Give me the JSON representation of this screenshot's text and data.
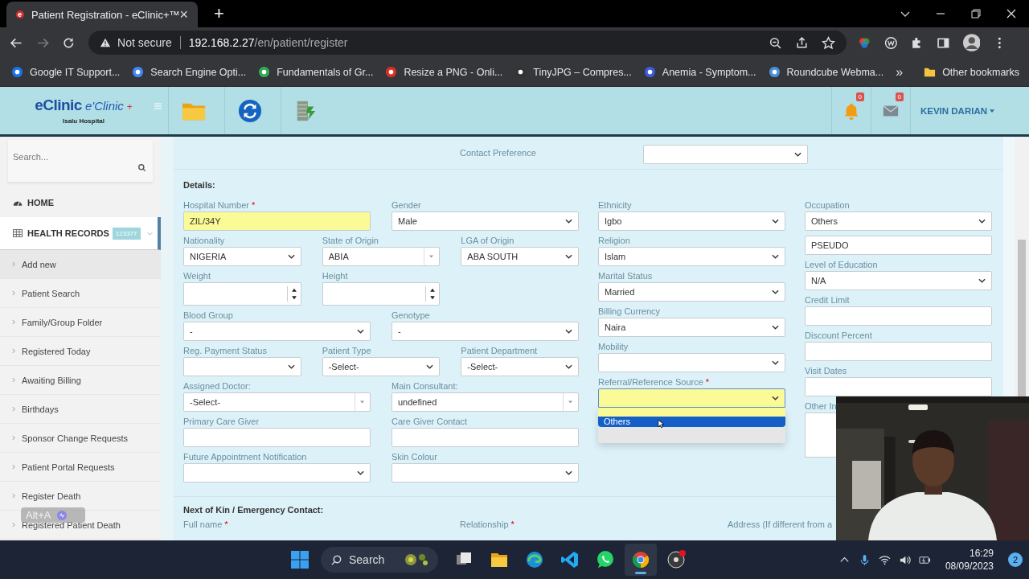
{
  "browser": {
    "tab": {
      "title": "Patient Registration - eClinic+™",
      "close": "×"
    },
    "new_tab": "+",
    "address": {
      "security": "Not secure",
      "host": "192.168.2.27",
      "path": "/en/patient/register"
    },
    "bookmarks": [
      {
        "label": "Google IT Support..."
      },
      {
        "label": "Search Engine Opti..."
      },
      {
        "label": "Fundamentals of Gr..."
      },
      {
        "label": "Resize a PNG - Onli..."
      },
      {
        "label": "TinyJPG – Compres..."
      },
      {
        "label": "Anemia - Symptom..."
      },
      {
        "label": "Roundcube Webma..."
      }
    ],
    "overflow": "»",
    "other_bookmarks": "Other bookmarks"
  },
  "header": {
    "logo": {
      "main": "eClinic",
      "alt": "e'Clinic",
      "mark": "+",
      "hospital": "Isalu Hospital"
    },
    "notifications": "0",
    "messages": "0",
    "user": "KEVIN DARIAN"
  },
  "sidebar": {
    "search": {
      "placeholder": "Search..."
    },
    "home": {
      "label": "HOME"
    },
    "section": {
      "label": "HEALTH RECORDS",
      "badge": "123377",
      "expanded": true
    },
    "items": [
      {
        "label": "Add new",
        "selected": true
      },
      {
        "label": "Patient Search",
        "selected": false
      },
      {
        "label": "Family/Group Folder",
        "selected": false
      },
      {
        "label": "Registered Today",
        "selected": false
      },
      {
        "label": "Awaiting Billing",
        "selected": false
      },
      {
        "label": "Birthdays",
        "selected": false
      },
      {
        "label": "Sponsor Change Requests",
        "selected": false
      },
      {
        "label": "Patient Portal Requests",
        "selected": false
      },
      {
        "label": "Register Death",
        "selected": false
      },
      {
        "label": "Registered Patient Death",
        "selected": false
      }
    ]
  },
  "keystroke_overlay": "Alt+A",
  "form": {
    "contact_preference": {
      "label": "Contact Preference",
      "kind": "select"
    },
    "details_title": "Details:",
    "left_rows": [
      [
        {
          "label": "Hospital Number",
          "required_mark": "*",
          "kind": "input",
          "value": "ZIL/34Y",
          "highlighted": true
        },
        {
          "label": "Gender",
          "kind": "select",
          "value": "Male",
          "highlighted": false
        }
      ],
      [
        {
          "label": "Nationality",
          "kind": "select",
          "value": "NIGERIA",
          "highlighted": false
        },
        {
          "label": "State of Origin",
          "kind": "combo",
          "value": "ABIA",
          "highlighted": false
        },
        {
          "label": "LGA of Origin",
          "kind": "select",
          "value": "ABA SOUTH",
          "highlighted": false
        }
      ],
      [
        {
          "label": "Weight",
          "kind": "number",
          "highlighted": false
        },
        {
          "label": "Height",
          "kind": "number",
          "highlighted": false
        }
      ],
      [
        {
          "label": "Blood Group",
          "kind": "select",
          "value": "-",
          "highlighted": false
        },
        {
          "label": "Genotype",
          "kind": "select",
          "value": "-",
          "highlighted": false
        }
      ],
      [
        {
          "label": "Reg. Payment Status",
          "kind": "select",
          "highlighted": false
        },
        {
          "label": "Patient Type",
          "kind": "select",
          "value": "-Select-",
          "highlighted": false
        },
        {
          "label": "Patient Department",
          "kind": "select",
          "value": "-Select-",
          "highlighted": false
        }
      ],
      [
        {
          "label": "Assigned Doctor:",
          "kind": "combo",
          "value": "-Select-",
          "highlighted": false
        },
        {
          "label": "Main Consultant:",
          "kind": "combo",
          "value": "undefined",
          "highlighted": false
        }
      ],
      [
        {
          "label": "Primary Care Giver",
          "kind": "input",
          "highlighted": false
        },
        {
          "label": "Care Giver Contact",
          "kind": "input",
          "highlighted": false
        }
      ],
      [
        {
          "label": "Future Appointment Notification",
          "kind": "select",
          "highlighted": false
        },
        {
          "label": "Skin Colour",
          "kind": "select",
          "highlighted": false
        }
      ]
    ],
    "right_columns": [
      [
        {
          "label": "Ethnicity",
          "kind": "select",
          "value": "Igbo",
          "highlighted": false
        },
        {
          "label": "Religion",
          "kind": "select",
          "value": "Islam",
          "highlighted": false
        },
        {
          "label": "Marital Status",
          "kind": "select",
          "value": "Married",
          "highlighted": false
        },
        {
          "label": "Billing Currency",
          "kind": "select",
          "value": "Naira",
          "highlighted": false
        },
        {
          "label": "Mobility",
          "kind": "select",
          "highlighted": false
        },
        {
          "label": "Referral/Reference Source",
          "required_mark": "*",
          "kind": "select",
          "highlighted": true,
          "expanded": true,
          "options": [
            {
              "label": "Others",
              "selected": true
            }
          ]
        }
      ],
      [
        {
          "label": "Occupation",
          "kind": "select",
          "value": "Others",
          "highlighted": false
        },
        {
          "kind": "input",
          "value": "PSEUDO",
          "highlighted": false
        },
        {
          "label": "Level of Education",
          "kind": "select",
          "value": "N/A",
          "highlighted": false
        },
        {
          "label": "Credit Limit",
          "kind": "input",
          "highlighted": false
        },
        {
          "label": "Discount Percent",
          "kind": "input",
          "highlighted": false
        },
        {
          "label": "Visit Dates",
          "kind": "input",
          "highlighted": false
        },
        {
          "label": "Other In",
          "kind": "textarea",
          "highlighted": false
        }
      ]
    ],
    "next_of_kin": {
      "title": "Next of Kin / Emergency Contact:",
      "labels": [
        {
          "label": "Full name",
          "required_mark": "*"
        },
        {
          "label": "Relationship",
          "required_mark": "*"
        },
        {
          "label": "Address (If different from a"
        }
      ]
    }
  },
  "taskbar": {
    "search": "Search",
    "time": "16:29",
    "date": "08/09/2023",
    "notifications": "2"
  }
}
